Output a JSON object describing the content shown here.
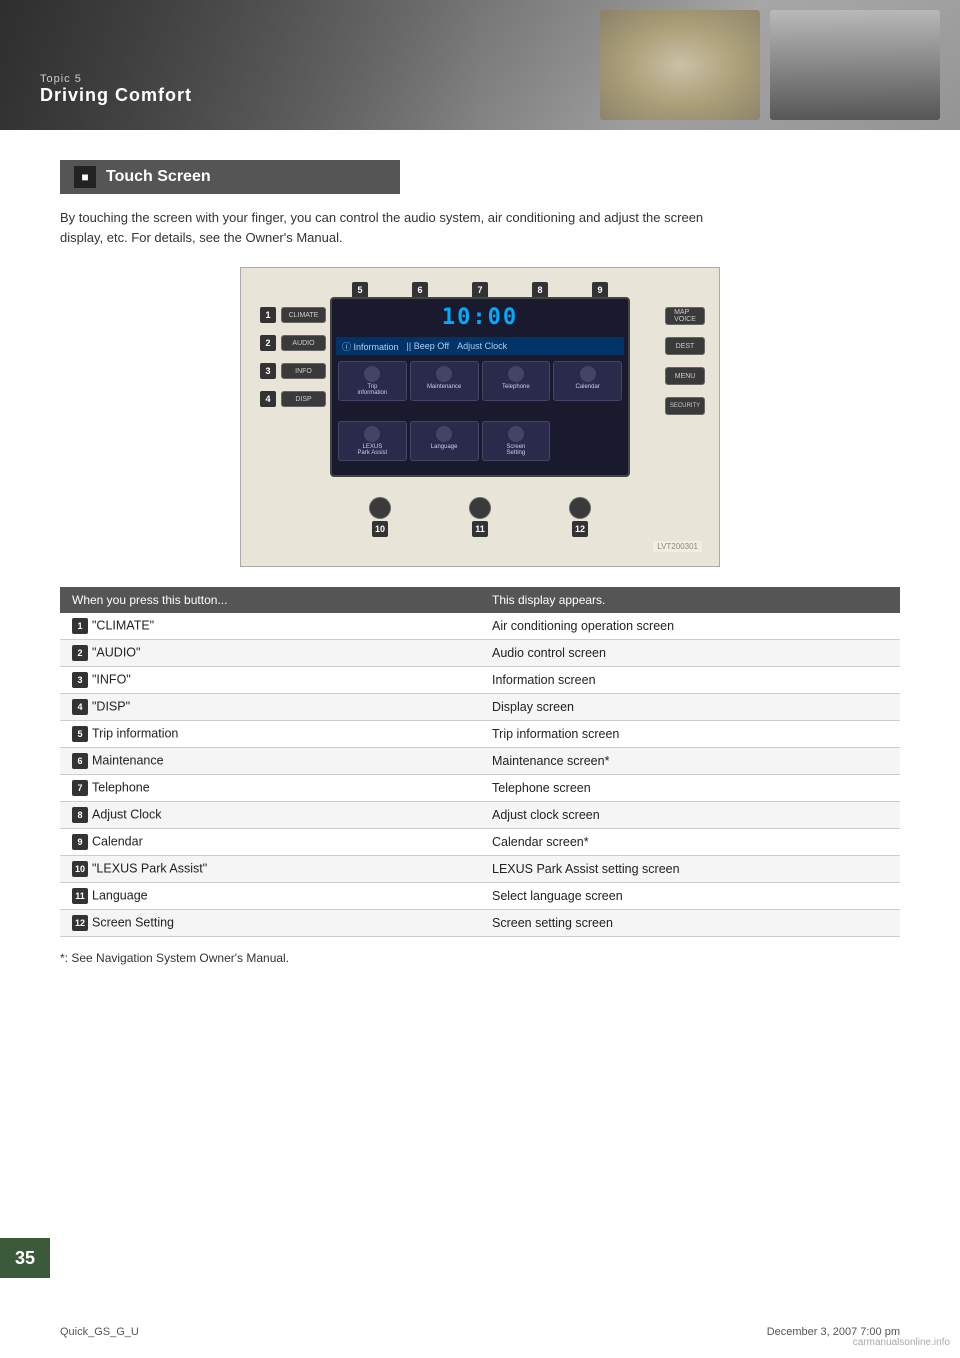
{
  "header": {
    "topic_label": "Topic 5",
    "title": "Driving Comfort"
  },
  "section": {
    "heading": "Touch Screen",
    "intro": "By touching the screen with your finger, you can control the audio system, air conditioning and adjust the screen display, etc. For details, see the Owner's Manual."
  },
  "diagram": {
    "time": "10:00",
    "ref": "LVT200301",
    "top_buttons": [
      {
        "num": "5",
        "label": "Trip information"
      },
      {
        "num": "6",
        "label": "Maintenance"
      },
      {
        "num": "7",
        "label": "Telephone"
      },
      {
        "num": "8",
        "label": "Adjust Clock"
      },
      {
        "num": "9",
        "label": "Calendar"
      }
    ],
    "left_buttons": [
      {
        "num": "1",
        "label": "CLIMATE"
      },
      {
        "num": "2",
        "label": "AUDIO"
      },
      {
        "num": "3",
        "label": "INFO"
      },
      {
        "num": "4",
        "label": "DISP"
      }
    ],
    "screen_buttons": [
      {
        "label": "Information",
        "sub": ""
      },
      {
        "label": "Beep Off",
        "sub": ""
      },
      {
        "label": "Adjust Clock",
        "sub": ""
      }
    ],
    "screen_buttons2": [
      {
        "label": "Trip information"
      },
      {
        "label": "Maintenance"
      },
      {
        "label": "Telephone"
      },
      {
        "label": "Calendar"
      }
    ],
    "screen_buttons3": [
      {
        "label": "LEXUS Park Assist"
      },
      {
        "label": "Language"
      },
      {
        "label": "Screen Setting"
      }
    ],
    "bottom_buttons": [
      {
        "num": "10",
        "label": "LEXUS Park Assist"
      },
      {
        "num": "11",
        "label": "Language"
      },
      {
        "num": "12",
        "label": "Screen Setting"
      }
    ],
    "right_buttons": [
      {
        "label": "MAP VOICE"
      },
      {
        "label": "DEST"
      },
      {
        "label": "MENU"
      },
      {
        "label": "SECURITY"
      }
    ]
  },
  "table": {
    "col1_header": "When you press this button...",
    "col2_header": "This display appears.",
    "rows": [
      {
        "num": "1",
        "button": "\"CLIMATE\"",
        "display": "Air conditioning operation screen"
      },
      {
        "num": "2",
        "button": "\"AUDIO\"",
        "display": "Audio control screen"
      },
      {
        "num": "3",
        "button": "\"INFO\"",
        "display": "Information screen"
      },
      {
        "num": "4",
        "button": "\"DISP\"",
        "display": "Display screen"
      },
      {
        "num": "5",
        "button": "Trip information",
        "display": "Trip information screen"
      },
      {
        "num": "6",
        "button": "Maintenance",
        "display": "Maintenance screen*"
      },
      {
        "num": "7",
        "button": "Telephone",
        "display": "Telephone screen"
      },
      {
        "num": "8",
        "button": "Adjust Clock",
        "display": "Adjust clock screen"
      },
      {
        "num": "9",
        "button": "Calendar",
        "display": "Calendar screen*"
      },
      {
        "num": "10",
        "button": "\"LEXUS Park Assist\"",
        "display": "LEXUS Park Assist setting screen"
      },
      {
        "num": "11",
        "button": "Language",
        "display": "Select language screen"
      },
      {
        "num": "12",
        "button": "Screen Setting",
        "display": "Screen setting screen"
      }
    ]
  },
  "footnote": "*: See Navigation System Owner's Manual.",
  "page_number": "35",
  "footer": {
    "left": "Quick_GS_G_U",
    "right": "December 3, 2007 7:00 pm"
  },
  "watermark": "carmanualsonline.info"
}
